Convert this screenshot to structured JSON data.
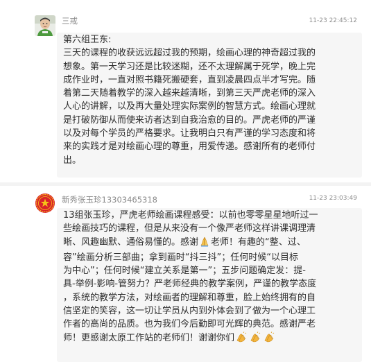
{
  "messages": [
    {
      "sender": "三戒",
      "time": "11-23 22:45:12",
      "lines": [
        "第六组王东:",
        "三天的课程的收获远远超过我的预期，绘画心理的神奇超过我的",
        "想象。第一天学习还是比较迷糊，还不太理解属于死学，晚上完",
        "成作业时，一直对照书籍死搬硬套，直到凌晨四点半才写完。随",
        "着第二天随着教学的深入越来越清晰，到第三天严虎老师的深入",
        "人心的讲解，以及再大量处理实际案例的智慧方式。绘画心理就",
        "是打破防御从而使来访者达到自我治愈的目的。严虎老师的严谨",
        "以及对每个学员的严格要求。让我明白只有严谨的学习态度和将",
        "来的实践才是对绘画心理的尊重，用爱传递。感谢所有的老师付",
        "出。"
      ]
    },
    {
      "sender": "新秀张玉珍13303465318",
      "time": "11-23 23:03:49",
      "lines": [
        "13组张玉珍，严虎老师绘画课程感受：以前也零零星星地听过一",
        "些绘画技巧的课程，但是从来没有一个像严老师这样讲课调理清",
        "晰、风趣幽默、通俗易懂的。感谢",
        "老师！有趣的“整、过、",
        "容”绘画分析三部曲；拿到画时“抖三抖”；任何时候“以目标",
        "为中心”；任何时候“建立关系是第一”；五步问题确定发：提-",
        "具-举例-影响-管努力？严老师经典的教学案例，严谨的教学态度",
        "，系统的教学方法，对绘画者的理解和尊重，脸上始终拥有的自",
        "信坚定的笑容，这一切让学员从内到外体会到了做为一个心理工",
        "作者的高尚的品质。也为我们今后勤即可光辉的典范。感谢严老",
        "师！更感谢太原工作站的老师们！谢谢你们"
      ]
    }
  ],
  "emoji": {
    "praying_hands": "praying-hands-emoji",
    "clapping_hands": "clapping-hands-emoji"
  },
  "colors": {
    "bubble": "#f6f6f6",
    "text": "#2d2d2d",
    "meta": "#8a8a8a",
    "badge_red": "#d9232a",
    "badge_gold": "#f5c518"
  }
}
